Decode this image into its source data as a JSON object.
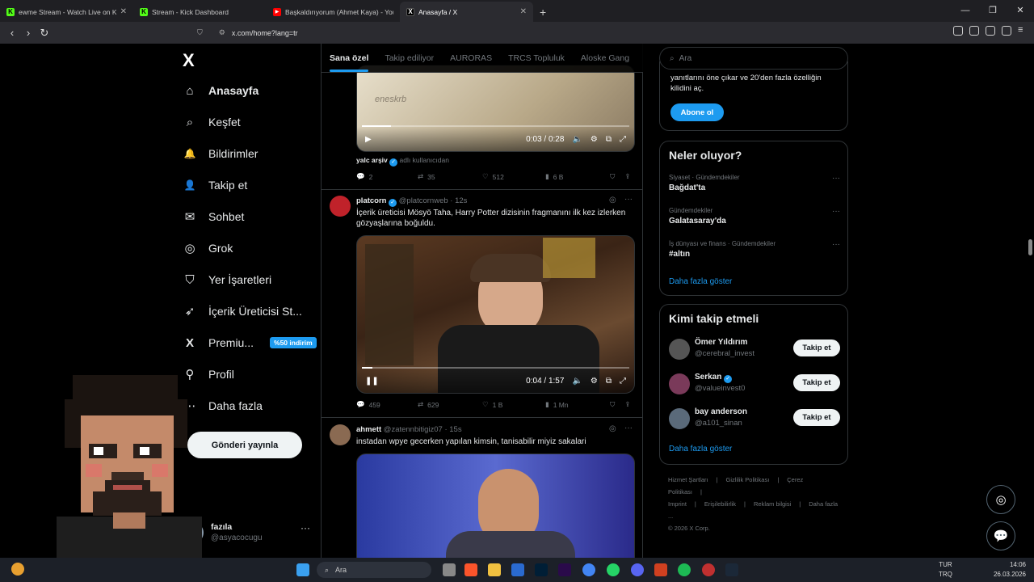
{
  "browser": {
    "tabs": [
      {
        "title": "ewme Stream - Watch Live on Ki",
        "fav_color": "#53fc18",
        "fav_text": "K"
      },
      {
        "title": "Stream - Kick Dashboard",
        "fav_color": "#53fc18",
        "fav_text": "K"
      },
      {
        "title": "Başkaldırıyorum (Ahmet Kaya) - YouT",
        "fav_color": "#ff0000",
        "fav_text": "▶"
      },
      {
        "title": "Anasayfa / X",
        "fav_color": "#000000",
        "fav_text": "X"
      }
    ],
    "url": "x.com/home?lang=tr"
  },
  "nav": {
    "logo": "X",
    "items": [
      {
        "label": "Anasayfa",
        "icon": "home-icon",
        "glyph": "⌂"
      },
      {
        "label": "Keşfet",
        "icon": "search-icon",
        "glyph": "⌕"
      },
      {
        "label": "Bildirimler",
        "icon": "bell-icon",
        "glyph": "🔔"
      },
      {
        "label": "Takip et",
        "icon": "add-user-icon",
        "glyph": "👤"
      },
      {
        "label": "Sohbet",
        "icon": "mail-icon",
        "glyph": "✉"
      },
      {
        "label": "Grok",
        "icon": "grok-icon",
        "glyph": "◎"
      },
      {
        "label": "Yer İşaretleri",
        "icon": "bookmark-icon",
        "glyph": "⛉"
      },
      {
        "label": "İçerik Üreticisi St...",
        "icon": "rocket-icon",
        "glyph": "➶"
      },
      {
        "label": "Premiu...",
        "icon": "x-premium-icon",
        "glyph": "X"
      },
      {
        "label": "Profil",
        "icon": "profile-icon",
        "glyph": "⚲"
      },
      {
        "label": "Daha fazla",
        "icon": "more-icon",
        "glyph": "⋯"
      }
    ],
    "premium_badge": "%50 indirim",
    "post_button": "Gönderi yayınla",
    "account": {
      "name": "fazıla",
      "handle": "@asyacocugu",
      "more": "···"
    }
  },
  "feed": {
    "tabs": [
      "Sana özel",
      "Takip ediliyor",
      "AURORAS",
      "TRCS Topluluk",
      "Aloske Gang"
    ],
    "posts": [
      {
        "video_watermark": "eneskrb",
        "video_time": "0:03 / 0:28",
        "video_progress": 0.11,
        "attribution_name": "yalc arşiv",
        "attribution_suffix": "adlı kullanıcıdan",
        "stats": {
          "replies": "2",
          "reposts": "35",
          "likes": "512",
          "views": "6 B"
        }
      },
      {
        "name": "platcorn",
        "handle": "@platcornweb",
        "time": "· 12s",
        "text": "İçerik üreticisi Mösyö Taha, Harry Potter dizisinin fragmanını ilk kez izlerken gözyaşlarına boğuldu.",
        "video_time": "0:04 / 1:57",
        "video_progress": 0.04,
        "stats": {
          "replies": "459",
          "reposts": "629",
          "likes": "1 B",
          "views": "1 Mn"
        }
      },
      {
        "name": "ahmett",
        "handle": "@zatennbitigiz07",
        "time": "· 15s",
        "text": "instadan wpye gecerken yapılan kimsin, tanisabilir miyiz sakalari"
      }
    ]
  },
  "sidebar": {
    "search_placeholder": "Ara",
    "premium_text": "yanıtlarını öne çıkar ve 20'den fazla özelliğin kilidini aç.",
    "premium_button": "Abone ol",
    "trends_title": "Neler oluyor?",
    "trends": [
      {
        "category": "Siyaset · Gündemdekiler",
        "name": "Bağdat'ta"
      },
      {
        "category": "Gündemdekiler",
        "name": "Galatasaray'da"
      },
      {
        "category": "İş dünyası ve finans · Gündemdekiler",
        "name": "#altın"
      }
    ],
    "show_more": "Daha fazla göster",
    "who_title": "Kimi takip etmeli",
    "suggestions": [
      {
        "name": "Ömer Yıldırım",
        "handle": "@cerebral_invest",
        "verified": false,
        "button": "Takip et"
      },
      {
        "name": "Serkan",
        "handle": "@valueinvest0",
        "verified": true,
        "button": "Takip et"
      },
      {
        "name": "bay anderson",
        "handle": "@a101_sinan",
        "verified": false,
        "button": "Takip et"
      }
    ],
    "show_more_2": "Daha fazla göster",
    "footer": [
      "Hizmet Şartları",
      "|",
      "Gizlilik Politikası",
      "|",
      "Çerez Politikası",
      "|",
      "Imprint",
      "|",
      "Erişilebilirlik",
      "|",
      "Reklam bilgisi",
      "|",
      "Daha fazla ...",
      "© 2026 X Corp."
    ]
  },
  "taskbar": {
    "search": "Ara",
    "lang": "TUR",
    "lang2": "TRQ",
    "time": "14:06",
    "date": "26.03.2026"
  }
}
